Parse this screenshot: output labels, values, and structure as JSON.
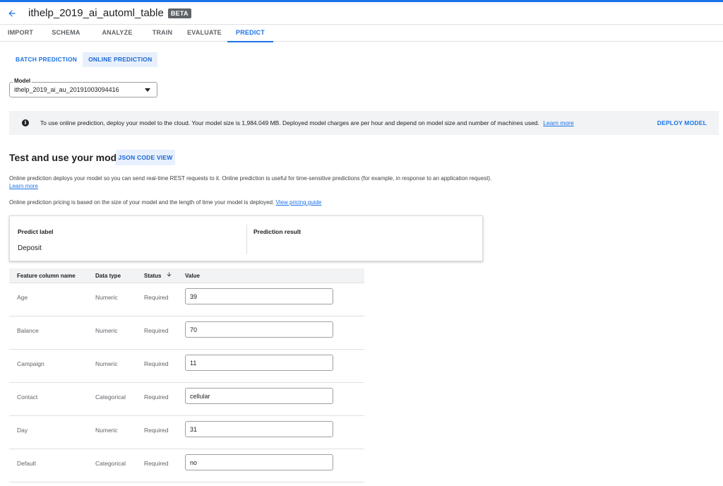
{
  "header": {
    "title": "ithelp_2019_ai_automl_table",
    "badge": "BETA"
  },
  "tabs": [
    {
      "label": "IMPORT",
      "active": false
    },
    {
      "label": "SCHEMA",
      "active": false
    },
    {
      "label": "ANALYZE",
      "active": false
    },
    {
      "label": "TRAIN",
      "active": false
    },
    {
      "label": "EVALUATE",
      "active": false
    },
    {
      "label": "PREDICT",
      "active": true
    }
  ],
  "subtabs": {
    "batch": "BATCH PREDICTION",
    "online": "ONLINE PREDICTION"
  },
  "model": {
    "label": "Model",
    "value": "ithelp_2019_ai_au_20191003094416"
  },
  "banner": {
    "text": "To use online prediction, deploy your model to the cloud. Your model size is 1,984.049 MB. Deployed model charges are per hour and depend on model size and number of machines used.",
    "link": "Learn more",
    "action": "DEPLOY MODEL"
  },
  "section": {
    "title": "Test and use your model",
    "json_button": "JSON CODE VIEW",
    "desc1": "Online prediction deploys your model so you can send real-time REST requests to it. Online prediction is useful for time-sensitive predictions (for example, in response to an application request).",
    "desc1_link": "Learn more",
    "desc2": "Online prediction pricing is based on the size of your model and the length of time your model is deployed.",
    "desc2_link": "View pricing guide"
  },
  "predict_card": {
    "label_heading": "Predict label",
    "label_value": "Deposit",
    "result_heading": "Prediction result"
  },
  "table": {
    "headers": {
      "feature": "Feature column name",
      "type": "Data type",
      "status": "Status",
      "value": "Value"
    },
    "rows": [
      {
        "feature": "Age",
        "type": "Numeric",
        "status": "Required",
        "value": "39"
      },
      {
        "feature": "Balance",
        "type": "Numeric",
        "status": "Required",
        "value": "70"
      },
      {
        "feature": "Campaign",
        "type": "Numeric",
        "status": "Required",
        "value": "11"
      },
      {
        "feature": "Contact",
        "type": "Categorical",
        "status": "Required",
        "value": "cellular"
      },
      {
        "feature": "Day",
        "type": "Numeric",
        "status": "Required",
        "value": "31"
      },
      {
        "feature": "Default",
        "type": "Categorical",
        "status": "Required",
        "value": "no"
      }
    ]
  },
  "icons": {
    "back": "arrow-back-icon",
    "dropdown": "dropdown-arrow-icon",
    "info": "info-icon",
    "sort": "arrow-down-icon"
  },
  "colors": {
    "accent": "#1a73e8",
    "banner_bg": "#f1f3f4",
    "chip_bg": "#e8f0fe"
  }
}
